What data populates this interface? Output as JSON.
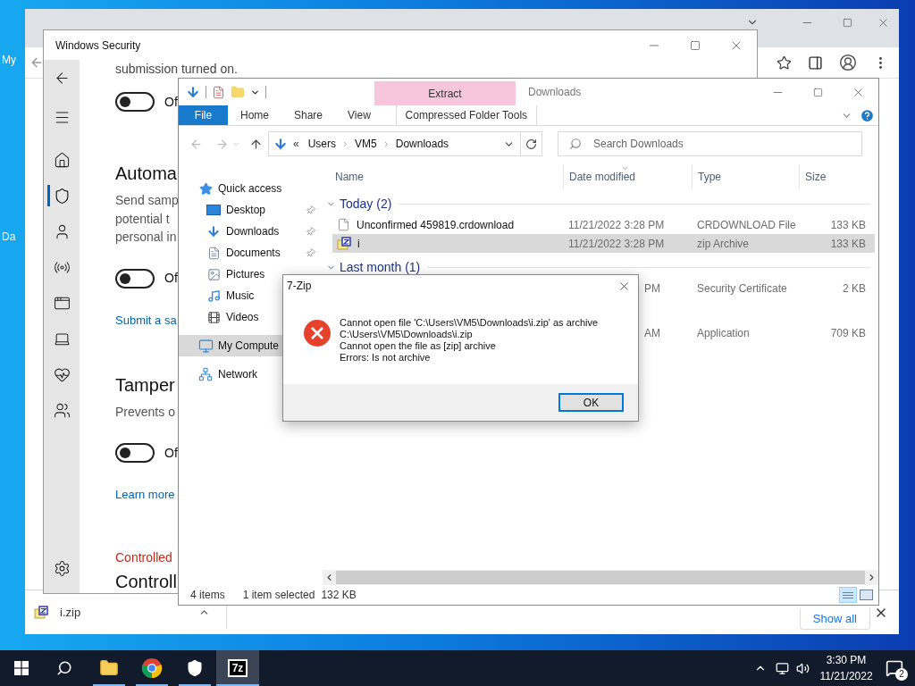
{
  "desktop": {
    "icons": [
      {
        "label": "My"
      },
      {
        "label": "Da"
      }
    ]
  },
  "browser": {
    "downloads_bar": {
      "items": [
        {
          "label": "i.zip"
        }
      ],
      "show_all": "Show all"
    }
  },
  "security": {
    "title": "Windows Security",
    "nav": [
      {
        "kind": "back",
        "selected": false
      },
      {
        "kind": "menu",
        "selected": false
      },
      {
        "kind": "home",
        "selected": false
      },
      {
        "kind": "shield",
        "selected": true
      },
      {
        "kind": "account",
        "selected": false
      },
      {
        "kind": "network",
        "selected": false
      },
      {
        "kind": "app",
        "selected": false
      },
      {
        "kind": "device",
        "selected": false
      },
      {
        "kind": "health",
        "selected": false
      },
      {
        "kind": "family",
        "selected": false
      },
      {
        "kind": "settings",
        "selected": false
      }
    ],
    "content": [
      {
        "kind": "cut_text",
        "text": "submission turned on."
      },
      {
        "kind": "toggle",
        "label": "Of",
        "on": false
      },
      {
        "kind": "heading",
        "text": "Automa"
      },
      {
        "kind": "desc",
        "lines": [
          "Send samp",
          "potential t",
          "personal in"
        ]
      },
      {
        "kind": "toggle",
        "label": "Of",
        "on": false
      },
      {
        "kind": "link",
        "text": "Submit a sa"
      },
      {
        "kind": "heading",
        "text": "Tamper"
      },
      {
        "kind": "desc",
        "lines": [
          "Prevents o"
        ]
      },
      {
        "kind": "toggle",
        "label": "Of",
        "on": false
      },
      {
        "kind": "link",
        "text": "Learn more"
      },
      {
        "kind": "warning",
        "text": "Controlled"
      },
      {
        "kind": "heading",
        "text": "Controll"
      }
    ]
  },
  "explorer": {
    "title": "Downloads",
    "context_tab": "Extract",
    "ribbon_tabs": [
      {
        "label": "File",
        "kind": "file",
        "selected": false
      },
      {
        "label": "Home",
        "kind": "tab",
        "selected": false
      },
      {
        "label": "Share",
        "kind": "tab",
        "selected": false
      },
      {
        "label": "View",
        "kind": "tab",
        "selected": false
      },
      {
        "label": "Compressed Folder Tools",
        "kind": "context",
        "selected": false
      }
    ],
    "address": {
      "overflow": "«",
      "parts": [
        "Users",
        "VM5",
        "Downloads"
      ]
    },
    "search": {
      "placeholder": "Search Downloads"
    },
    "nav_pane": [
      {
        "label": "Quick access",
        "kind": "star",
        "selected": false,
        "children": [
          {
            "label": "Desktop",
            "kind": "desktop",
            "pinned": true,
            "selected": false
          },
          {
            "label": "Downloads",
            "kind": "downloads",
            "pinned": true,
            "selected": false
          },
          {
            "label": "Documents",
            "kind": "documents",
            "pinned": true,
            "selected": false
          },
          {
            "label": "Pictures",
            "kind": "pictures",
            "pinned": false,
            "selected": false
          },
          {
            "label": "Music",
            "kind": "music",
            "pinned": false,
            "selected": false
          },
          {
            "label": "Videos",
            "kind": "videos",
            "pinned": false,
            "selected": false
          }
        ]
      },
      {
        "label": "My Compute",
        "kind": "computer",
        "selected": true
      },
      {
        "label": "Network",
        "kind": "network",
        "selected": false
      }
    ],
    "columns": [
      "Name",
      "Date modified",
      "Type",
      "Size"
    ],
    "groups": [
      {
        "label": "Today (2)",
        "rows": [
          {
            "kind": "crdownload",
            "name": "Unconfirmed 459819.crdownload",
            "date": "11/21/2022 3:28 PM",
            "type": "CRDOWNLOAD File",
            "size": "133 KB",
            "selected": false,
            "covered": false
          },
          {
            "kind": "zip",
            "name": "i",
            "date": "11/21/2022 3:28 PM",
            "type": "zip Archive",
            "size": "133 KB",
            "selected": true,
            "covered": false
          }
        ]
      },
      {
        "label": "Last month (1)",
        "rows": [
          {
            "date": "PM",
            "type": "Security Certificate",
            "size": "2 KB",
            "selected": false,
            "covered": true
          }
        ]
      },
      {
        "rows": [
          {
            "date": "AM",
            "type": "Application",
            "size": "709 KB",
            "selected": false,
            "covered": true
          }
        ]
      }
    ],
    "status": {
      "count": "4 items",
      "selection": "1 item selected",
      "size": "132 KB"
    }
  },
  "dialog": {
    "title": "7-Zip",
    "lines": [
      "Cannot open file 'C:\\Users\\VM5\\Downloads\\i.zip' as archive",
      "C:\\Users\\VM5\\Downloads\\i.zip",
      "Cannot open the file as [zip] archive",
      "Errors: Is not archive"
    ],
    "button": "OK"
  },
  "taskbar": {
    "apps": [
      {
        "kind": "start",
        "open": false,
        "selected": false
      },
      {
        "kind": "search",
        "open": false,
        "selected": false
      },
      {
        "kind": "explorer",
        "open": true,
        "selected": false
      },
      {
        "kind": "chrome",
        "open": true,
        "selected": false
      },
      {
        "kind": "security",
        "open": true,
        "selected": false
      },
      {
        "kind": "sevenzip",
        "label": "7z",
        "open": true,
        "selected": true
      }
    ],
    "time": "3:30 PM",
    "date": "11/21/2022",
    "notifications": "2"
  }
}
